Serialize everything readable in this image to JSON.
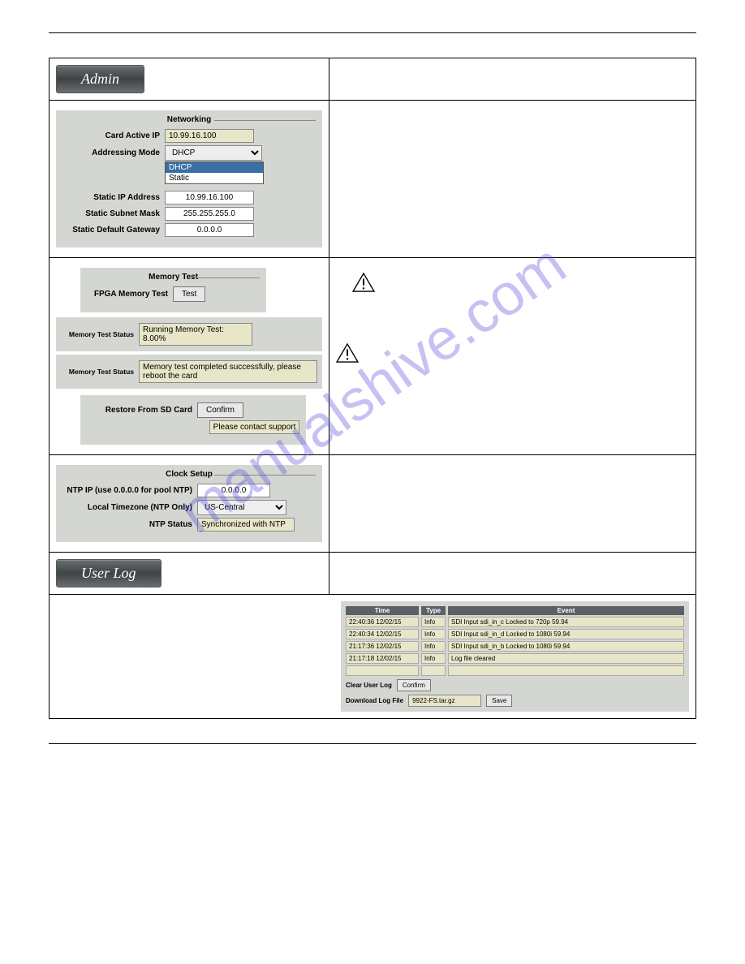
{
  "watermark": "manualshive.com",
  "tabs": {
    "admin": "Admin",
    "userlog": "User Log"
  },
  "networking": {
    "heading": "Networking",
    "card_active_ip": {
      "label": "Card Active IP",
      "value": "10.99.16.100"
    },
    "addressing_mode": {
      "label": "Addressing Mode",
      "selected": "DHCP",
      "options": [
        "DHCP",
        "Static"
      ]
    },
    "static_ip": {
      "label": "Static IP Address",
      "value": "10.99.16.100"
    },
    "subnet": {
      "label": "Static Subnet Mask",
      "value": "255.255.255.0"
    },
    "gateway": {
      "label": "Static Default Gateway",
      "value": "0.0.0.0"
    }
  },
  "memorytest": {
    "heading": "Memory Test",
    "fpga_label": "FPGA Memory Test",
    "test_button": "Test",
    "status1": {
      "label": "Memory Test Status",
      "value": "Running Memory Test: 8.00%"
    },
    "status2": {
      "label": "Memory Test Status",
      "value": "Memory test completed successfully, please reboot the card"
    },
    "restore": {
      "label": "Restore From SD Card",
      "button": "Confirm",
      "msg": "Please contact support"
    }
  },
  "clock": {
    "heading": "Clock Setup",
    "ntp_ip": {
      "label": "NTP IP (use 0.0.0.0 for pool NTP)",
      "value": "0.0.0.0"
    },
    "timezone": {
      "label": "Local Timezone (NTP Only)",
      "value": "US-Central"
    },
    "status": {
      "label": "NTP Status",
      "value": "Synchronized with NTP"
    }
  },
  "userlog": {
    "headers": {
      "time": "Time",
      "type": "Type",
      "event": "Event"
    },
    "rows": [
      {
        "time": "22:40:36 12/02/15",
        "type": "Info",
        "event": "SDI Input sdi_in_c Locked to 720p 59.94"
      },
      {
        "time": "22:40:34 12/02/15",
        "type": "Info",
        "event": "SDI Input sdi_in_d Locked to 1080i 59.94"
      },
      {
        "time": "21:17:36 12/02/15",
        "type": "Info",
        "event": "SDI Input sdi_in_b Locked to 1080i 59.94"
      },
      {
        "time": "21:17:18 12/02/15",
        "type": "Info",
        "event": "Log file cleared"
      }
    ],
    "clear": {
      "label": "Clear User Log",
      "button": "Confirm"
    },
    "download": {
      "label": "Download Log File",
      "file": "9922-FS.tar.gz",
      "button": "Save"
    }
  }
}
